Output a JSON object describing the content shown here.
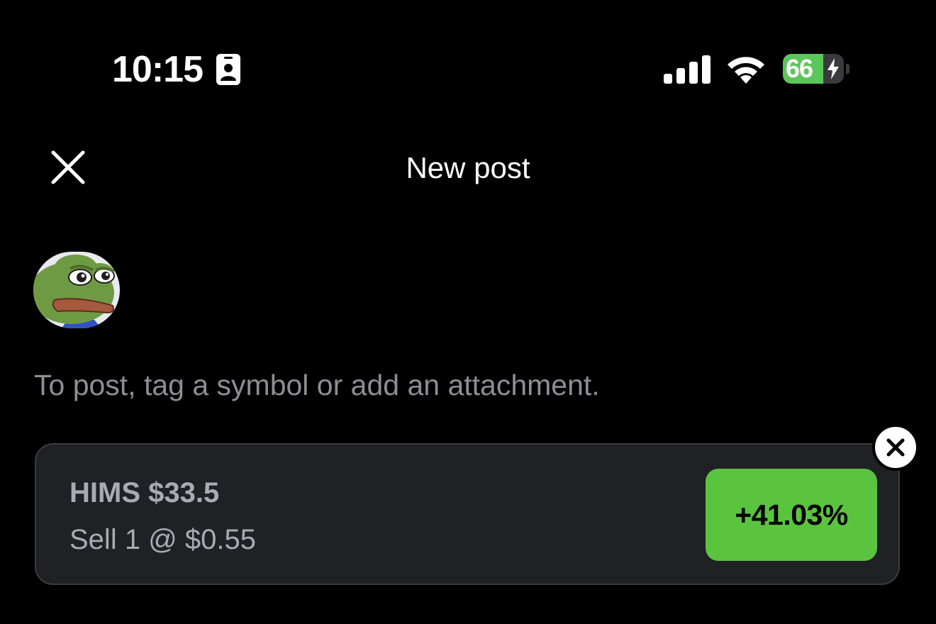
{
  "status_bar": {
    "time": "10:15",
    "battery_level": "66",
    "battery_fraction": 0.66,
    "icons": [
      "id-card-icon",
      "signal-icon",
      "wifi-icon",
      "bolt-icon"
    ]
  },
  "header": {
    "title": "New post",
    "close_icon": "close-icon"
  },
  "composer": {
    "avatar": "frog-avatar",
    "hint": "To post, tag a symbol or add an attachment."
  },
  "attachment": {
    "title": "HIMS $33.5",
    "detail": "Sell 1 @ $0.55",
    "change": "+41.03%",
    "remove_icon": "close-icon"
  },
  "colors": {
    "background": "#000000",
    "card": "#202124",
    "positive": "#5bc43f",
    "battery": "#5bc75a",
    "muted_text": "#8e8e93"
  }
}
